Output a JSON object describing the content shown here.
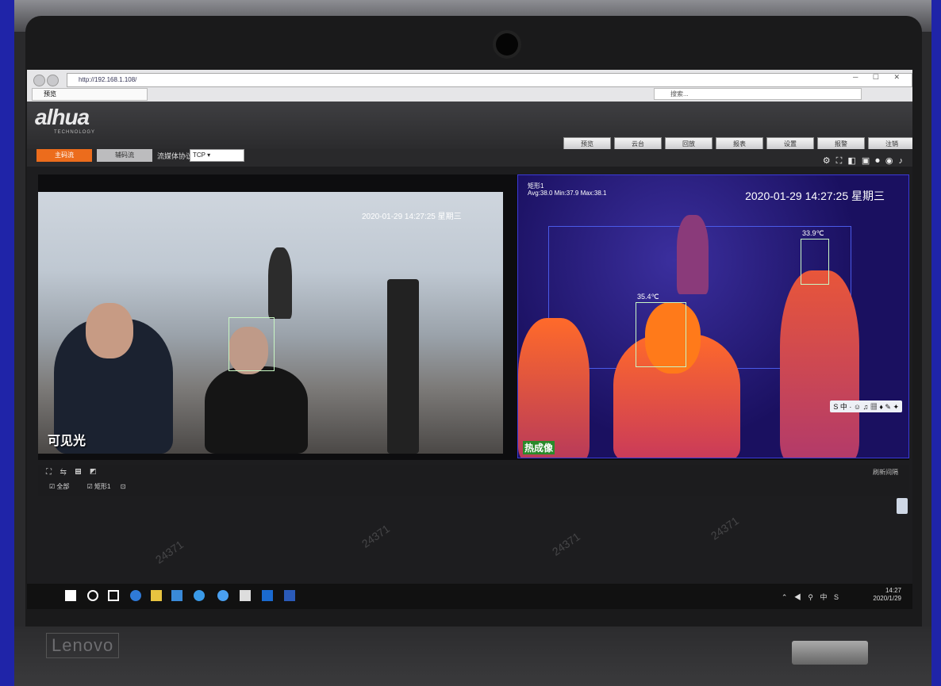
{
  "browser": {
    "url": "http://192.168.1.108/",
    "tab_title": "预览",
    "search_placeholder": "搜索..."
  },
  "app": {
    "logo": "alhua",
    "logo_sub": "TECHNOLOGY",
    "nav_tabs": [
      "预览",
      "云台",
      "回放",
      "报表",
      "设置",
      "报警",
      "注销"
    ],
    "main_stream_button": "主码流",
    "sub_stream_button": "辅码流",
    "protocol_label": "流媒体协议",
    "protocol_value": "TCP"
  },
  "visible_view": {
    "label": "可见光",
    "overlay_time": "2020-01-29 14:27:25 星期三",
    "box_label": "矩形1",
    "box_temp_visible": "35.4℃"
  },
  "thermal_view": {
    "title": "矩形1",
    "stats": "Avg:38.0 Min:37.9 Max:38.1",
    "time": "2020-01-29 14:27:25 星期三",
    "readings": [
      "33.9℃",
      "35.4℃"
    ],
    "label": "热成像"
  },
  "controls": {
    "checkbox_all": "全部",
    "checkbox_rect": "矩形1",
    "refresh": "刷新间隔"
  },
  "watermark": "24371",
  "taskbar": {
    "time": "14:27",
    "date": "2020/1/29"
  },
  "laptop_brand": "Lenovo"
}
